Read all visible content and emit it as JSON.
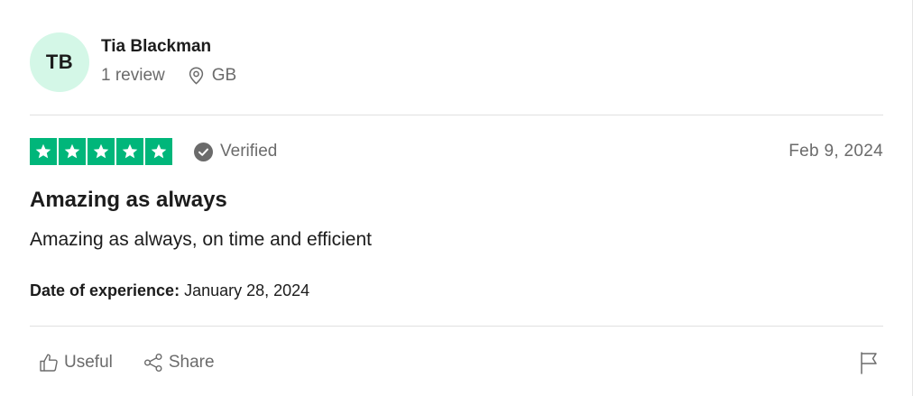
{
  "reviewer": {
    "initials": "TB",
    "name": "Tia Blackman",
    "review_count": "1 review",
    "location": "GB",
    "avatar_color": "#d4f7e7"
  },
  "review": {
    "rating": 5,
    "max_rating": 5,
    "star_color": "#00b67a",
    "verified_label": "Verified",
    "date": "Feb 9, 2024",
    "title": "Amazing as always",
    "body": "Amazing as always, on time and efficient",
    "experience_label": "Date of experience:",
    "experience_date": "January 28, 2024"
  },
  "actions": {
    "useful_label": "Useful",
    "share_label": "Share"
  },
  "icons": {
    "location": "location-pin-icon",
    "verified": "check-circle-icon",
    "useful": "thumbs-up-icon",
    "share": "share-icon",
    "flag": "flag-icon"
  }
}
